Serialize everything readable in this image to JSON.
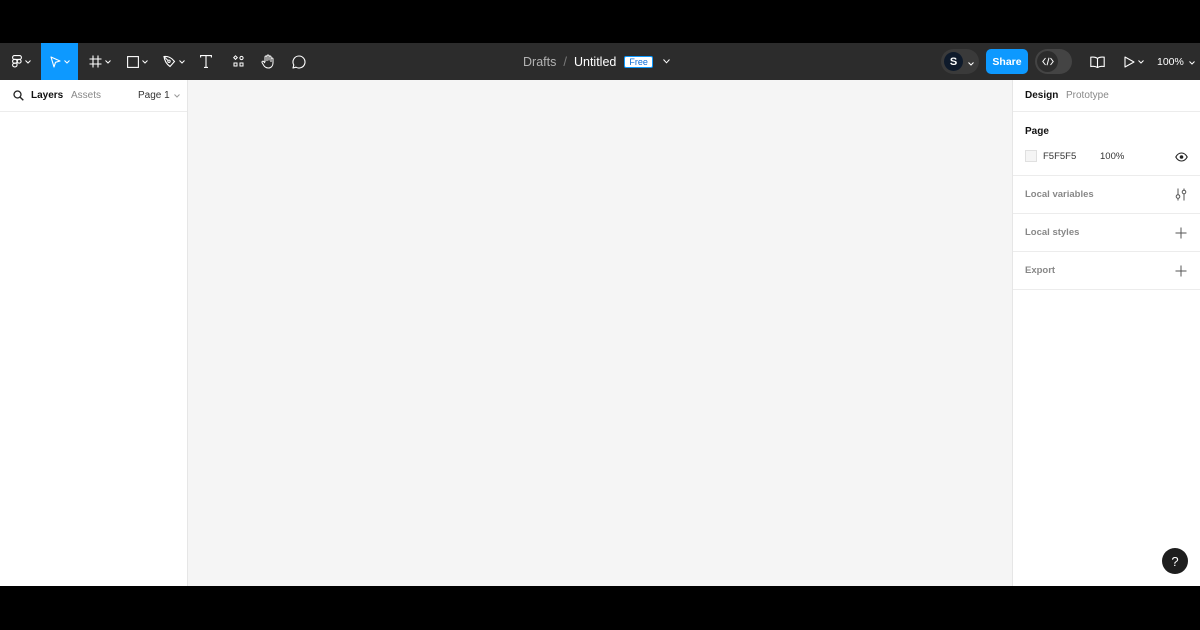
{
  "toolbar": {
    "breadcrumb": "Drafts",
    "separator": "/",
    "doc_title": "Untitled",
    "plan_badge": "Free",
    "avatar_initial": "S",
    "share_label": "Share",
    "zoom_label": "100%",
    "tools": [
      "main-menu",
      "move",
      "frame",
      "shape",
      "pen",
      "text",
      "actions",
      "hand",
      "comment"
    ]
  },
  "left_panel": {
    "tabs": {
      "layers": "Layers",
      "assets": "Assets"
    },
    "page_selector": "Page 1"
  },
  "right_panel": {
    "tabs": {
      "design": "Design",
      "prototype": "Prototype"
    },
    "page": {
      "heading": "Page",
      "fill_hex": "F5F5F5",
      "opacity": "100%"
    },
    "sections": [
      {
        "label": "Local variables",
        "icon": "sliders-icon"
      },
      {
        "label": "Local styles",
        "icon": "plus-icon"
      },
      {
        "label": "Export",
        "icon": "plus-icon"
      }
    ]
  },
  "help_label": "?",
  "colors": {
    "toolbar_bg": "#2c2c2c",
    "accent": "#0d99ff",
    "canvas_bg": "#F5F5F5"
  }
}
